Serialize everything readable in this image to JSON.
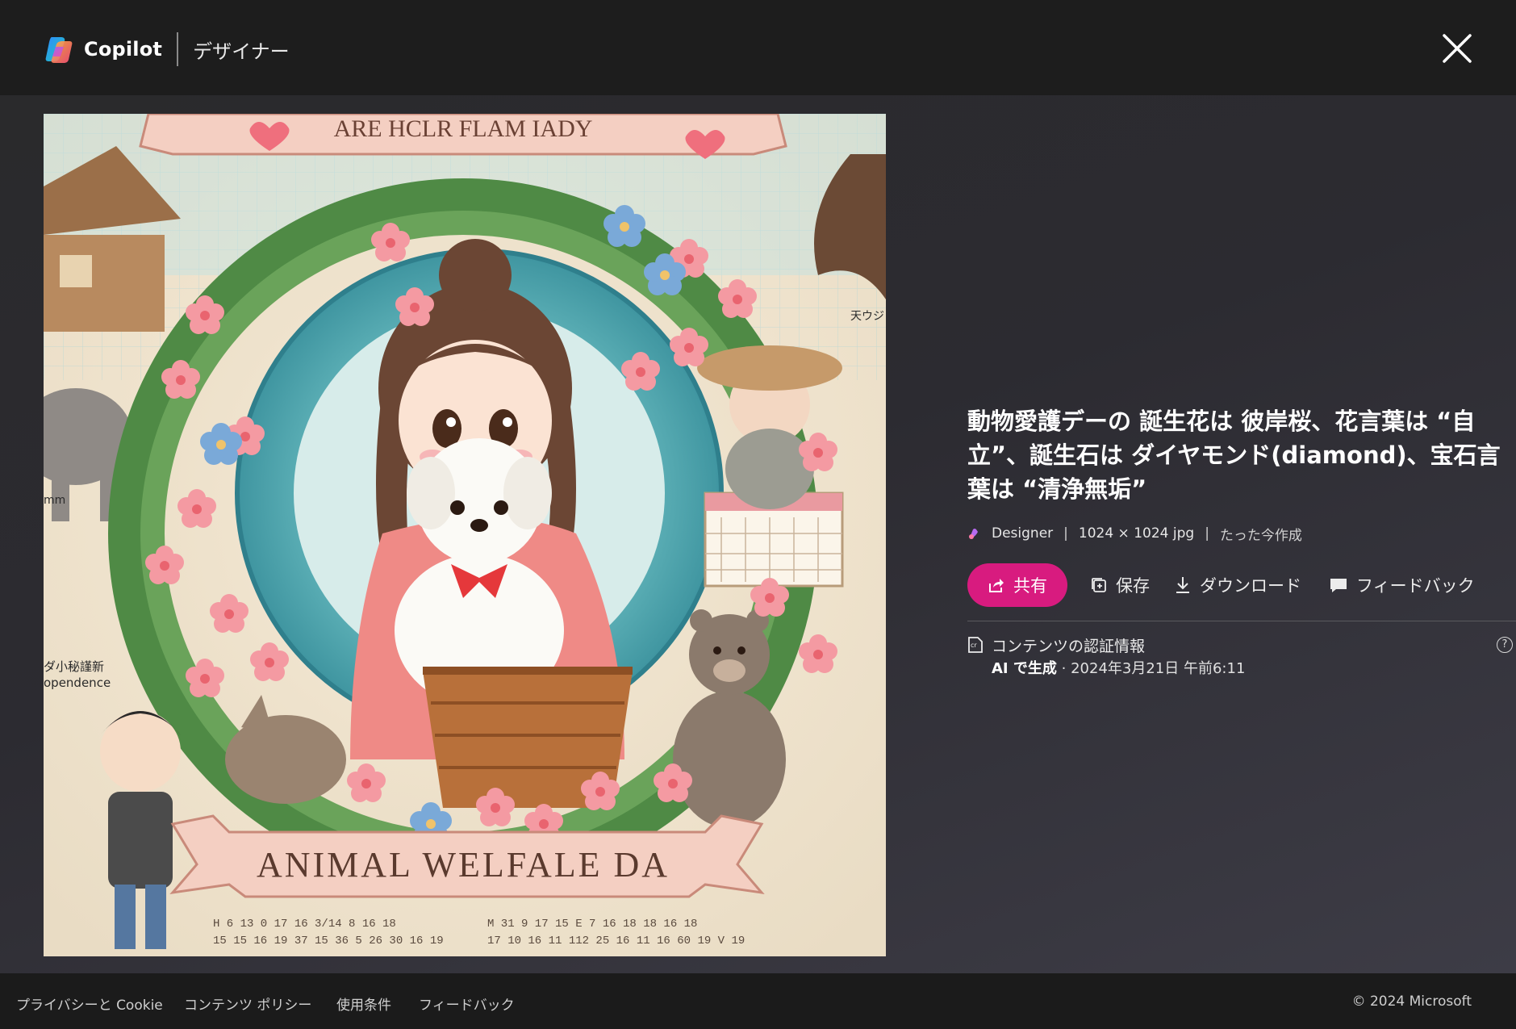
{
  "header": {
    "app_name": "Copilot",
    "sub_name": "デザイナー",
    "close_label": "閉じる"
  },
  "image": {
    "banner_top_text": "ARE HCLR FLAM IADY",
    "banner_bottom_text": "ANIMAL WELFALE DA",
    "left_sign_text": "ダ小秘謹新",
    "left_sign_text2": "opendence",
    "left_sign_text3": "mm",
    "right_sign_text": "天ウジ",
    "calendar_row1": "H 6 13 0 17 16 3/14 8 16 18",
    "calendar_row2": "15 15 16 19 37 15 36 5 26 30 16 19",
    "calendar_row3": "M 31 9 17 15 E 7 16 18 18 16 18",
    "calendar_row4": "17 10 16 11 112 25 16 11 16 60 19 V 19"
  },
  "info": {
    "title": "動物愛護デーの 誕生花は 彼岸桜、花言葉は “自立”、誕生石は ダイヤモンド(diamond)、宝石言葉は “清浄無垢”",
    "meta": {
      "source": "Designer",
      "dimensions": "1024 × 1024 jpg",
      "created": "たった今作成"
    },
    "actions": {
      "share": "共有",
      "save": "保存",
      "download": "ダウンロード",
      "feedback": "フィードバック"
    },
    "credentials": {
      "title": "コンテンツの認証情報",
      "ai_label": "AI で生成",
      "date": "· 2024年3月21日 午前6:11",
      "help": "?"
    }
  },
  "footer": {
    "links": [
      "プライバシーと Cookie",
      "コンテンツ ポリシー",
      "使用条件",
      "フィードバック"
    ],
    "copyright": "© 2024 Microsoft"
  },
  "colors": {
    "accent": "#d81b7f",
    "background": "#202020",
    "header": "#1d1d1d",
    "footer": "#1b1b1b"
  },
  "icons": [
    "copilot-logo-icon",
    "close-icon",
    "designer-icon",
    "share-icon",
    "save-icon",
    "download-icon",
    "feedback-icon",
    "credentials-icon",
    "help-icon"
  ]
}
